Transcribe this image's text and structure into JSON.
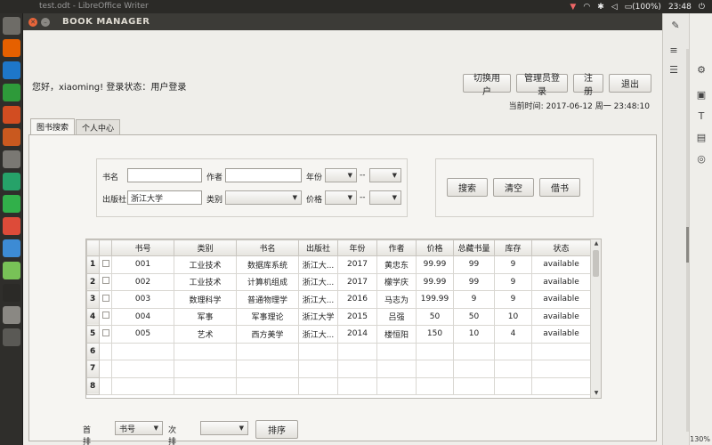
{
  "system": {
    "window_title": "test.odt - LibreOffice Writer",
    "battery": "(100%)",
    "clock": "23:48"
  },
  "launcher": [
    {
      "icon": "dash-icon",
      "color": "#6e6c67"
    },
    {
      "icon": "firefox-icon",
      "color": "#e66000"
    },
    {
      "icon": "writer-icon",
      "color": "#1e77c9"
    },
    {
      "icon": "calc-icon",
      "color": "#2e9a3a"
    },
    {
      "icon": "impress-icon",
      "color": "#d24d21"
    },
    {
      "icon": "software-icon",
      "color": "#c9591f"
    },
    {
      "icon": "settings-icon",
      "color": "#7a7873"
    },
    {
      "icon": "clion-icon",
      "color": "#26a269"
    },
    {
      "icon": "pycharm-icon",
      "color": "#31b04a"
    },
    {
      "icon": "chrome-icon",
      "color": "#dd4b39"
    },
    {
      "icon": "app-icon",
      "color": "#3d8bd4"
    },
    {
      "icon": "android-icon",
      "color": "#78c257"
    },
    {
      "icon": "terminal-icon",
      "color": "#2b2a27"
    },
    {
      "icon": "drive-icon",
      "color": "#8a8883"
    },
    {
      "icon": "trash-icon",
      "color": "#5a5955"
    }
  ],
  "app": {
    "title": "BOOK MANAGER",
    "greeting": "您好，xiaoming! 登录状态：用户登录",
    "top_buttons": {
      "switch_user": "切换用户",
      "admin_login": "管理员登录",
      "register": "注册",
      "exit": "退出"
    },
    "datetime": "当前时间: 2017-06-12 周一 23:48:10",
    "tabs": {
      "search": "图书搜索",
      "personal": "个人中心"
    },
    "filters": {
      "title_label": "书名",
      "title_value": "",
      "author_label": "作者",
      "author_value": "",
      "year_label": "年份",
      "year_sep": "--",
      "publisher_label": "出版社",
      "publisher_value": "浙江大学",
      "category_label": "类别",
      "price_label": "价格",
      "price_sep": "--"
    },
    "actions": {
      "search": "搜索",
      "clear": "清空",
      "borrow": "借书"
    },
    "table": {
      "headers": [
        "书号",
        "类别",
        "书名",
        "出版社",
        "年份",
        "作者",
        "价格",
        "总藏书量",
        "库存",
        "状态"
      ],
      "rows": [
        {
          "num": "1",
          "cells": [
            "001",
            "工业技术",
            "数据库系统",
            "浙江大...",
            "2017",
            "黄忠东",
            "99.99",
            "99",
            "9",
            "available"
          ]
        },
        {
          "num": "2",
          "cells": [
            "002",
            "工业技术",
            "计算机组成",
            "浙江大...",
            "2017",
            "檬学庆",
            "99.99",
            "99",
            "9",
            "available"
          ]
        },
        {
          "num": "3",
          "cells": [
            "003",
            "数理科学",
            "普通物理学",
            "浙江大...",
            "2016",
            "马志为",
            "199.99",
            "9",
            "9",
            "available"
          ]
        },
        {
          "num": "4",
          "cells": [
            "004",
            "军事",
            "军事理论",
            "浙江大学",
            "2015",
            "吕强",
            "50",
            "50",
            "10",
            "available"
          ]
        },
        {
          "num": "5",
          "cells": [
            "005",
            "艺术",
            "西方美学",
            "浙江大...",
            "2014",
            "楼恒阳",
            "150",
            "10",
            "4",
            "available"
          ]
        },
        {
          "num": "6",
          "cells": [
            "",
            "",
            "",
            "",
            "",
            "",
            "",
            "",
            "",
            ""
          ]
        },
        {
          "num": "7",
          "cells": [
            "",
            "",
            "",
            "",
            "",
            "",
            "",
            "",
            "",
            ""
          ]
        },
        {
          "num": "8",
          "cells": [
            "",
            "",
            "",
            "",
            "",
            "",
            "",
            "",
            "",
            ""
          ]
        }
      ]
    },
    "sort": {
      "primary_label": "首排序:",
      "primary_value": "书号",
      "secondary_label": "次排序:",
      "secondary_value": "",
      "button": "排序"
    }
  },
  "libreoffice": {
    "zoom": "130%"
  }
}
